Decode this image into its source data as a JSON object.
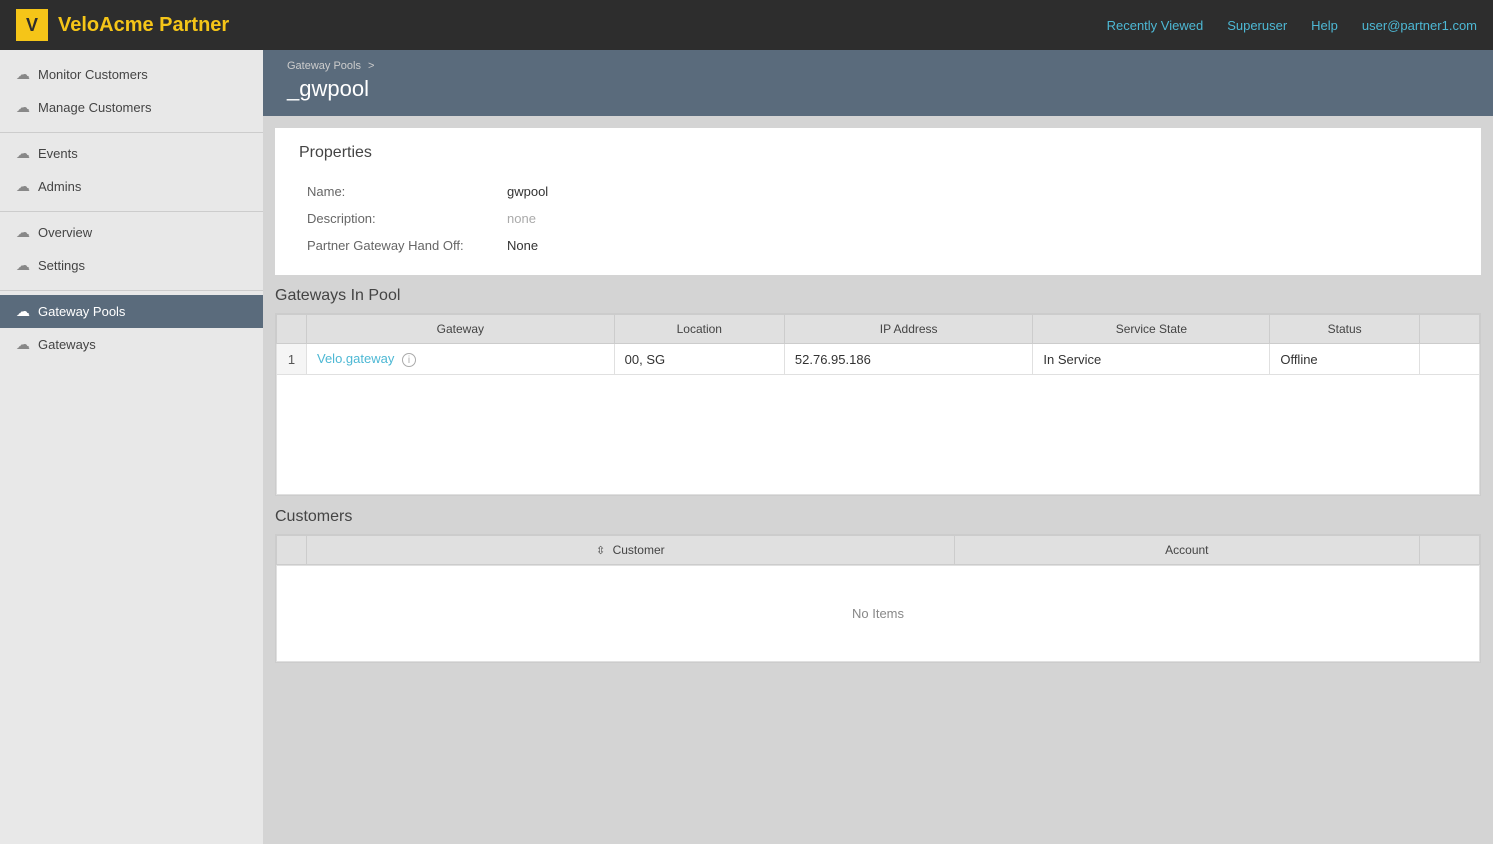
{
  "app": {
    "logo_letter": "V",
    "title": "VeloAcme Partner"
  },
  "topnav": {
    "links": [
      {
        "label": "Recently Viewed",
        "id": "recently-viewed"
      },
      {
        "label": "Superuser",
        "id": "superuser"
      },
      {
        "label": "Help",
        "id": "help"
      }
    ],
    "user": "user@partner1.com"
  },
  "sidebar": {
    "sections": [
      {
        "items": [
          {
            "label": "Monitor Customers",
            "id": "monitor-customers",
            "active": false
          },
          {
            "label": "Manage Customers",
            "id": "manage-customers",
            "active": false
          }
        ]
      },
      {
        "items": [
          {
            "label": "Events",
            "id": "events",
            "active": false
          },
          {
            "label": "Admins",
            "id": "admins",
            "active": false
          }
        ]
      },
      {
        "items": [
          {
            "label": "Overview",
            "id": "overview",
            "active": false
          },
          {
            "label": "Settings",
            "id": "settings",
            "active": false
          }
        ]
      },
      {
        "items": [
          {
            "label": "Gateway Pools",
            "id": "gateway-pools",
            "active": true
          },
          {
            "label": "Gateways",
            "id": "gateways",
            "active": false
          }
        ]
      }
    ]
  },
  "breadcrumb": {
    "parent": "Gateway Pools",
    "separator": ">"
  },
  "page": {
    "title": "_gwpool"
  },
  "properties": {
    "section_title": "Properties",
    "fields": [
      {
        "label": "Name:",
        "value": "gwpool",
        "id": "name",
        "style": "normal"
      },
      {
        "label": "Description:",
        "value": "none",
        "id": "description",
        "style": "muted"
      },
      {
        "label": "Partner Gateway Hand Off:",
        "value": "None",
        "id": "handoff",
        "style": "normal"
      }
    ]
  },
  "gateways_in_pool": {
    "section_title": "Gateways In Pool",
    "columns": [
      "",
      "Gateway",
      "Location",
      "IP Address",
      "Service State",
      "Status",
      ""
    ],
    "rows": [
      {
        "num": "1",
        "gateway": "Velo.gateway",
        "location": "00, SG",
        "ip_address": "52.76.95.186",
        "service_state": "In Service",
        "status": "Offline"
      }
    ]
  },
  "customers": {
    "section_title": "Customers",
    "columns": [
      "",
      "Customer",
      "Account",
      ""
    ],
    "no_items_text": "No Items"
  }
}
